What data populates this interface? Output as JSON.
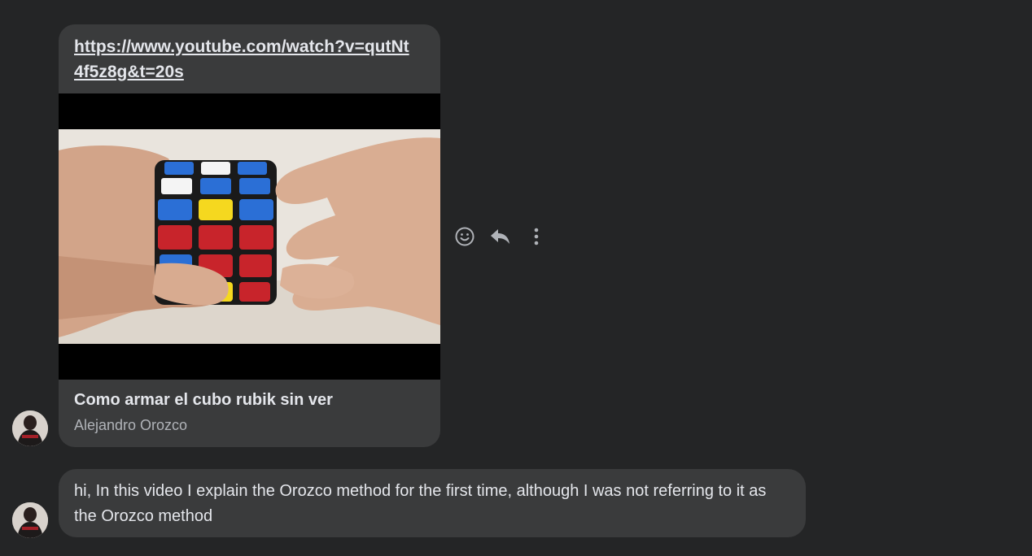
{
  "messages": [
    {
      "type": "link_preview",
      "url": "https://www.youtube.com/watch?v=qutNt4f5z8g&t=20s",
      "preview_title": "Como armar el cubo rubik sin ver",
      "preview_channel": "Alejandro Orozco",
      "thumbnail_icon": "video-thumbnail-rubiks-cube"
    },
    {
      "type": "text",
      "text": "hi, In this video I explain the Orozco method for the first time, although I was not referring to it as the Orozco method"
    }
  ],
  "actions": [
    {
      "icon": "react-smiley-icon"
    },
    {
      "icon": "reply-icon"
    },
    {
      "icon": "more-options-icon"
    }
  ],
  "colors": {
    "background": "#242526",
    "bubble": "#3a3b3c",
    "text": "#e4e6eb",
    "secondary_text": "#b0b3b8"
  }
}
